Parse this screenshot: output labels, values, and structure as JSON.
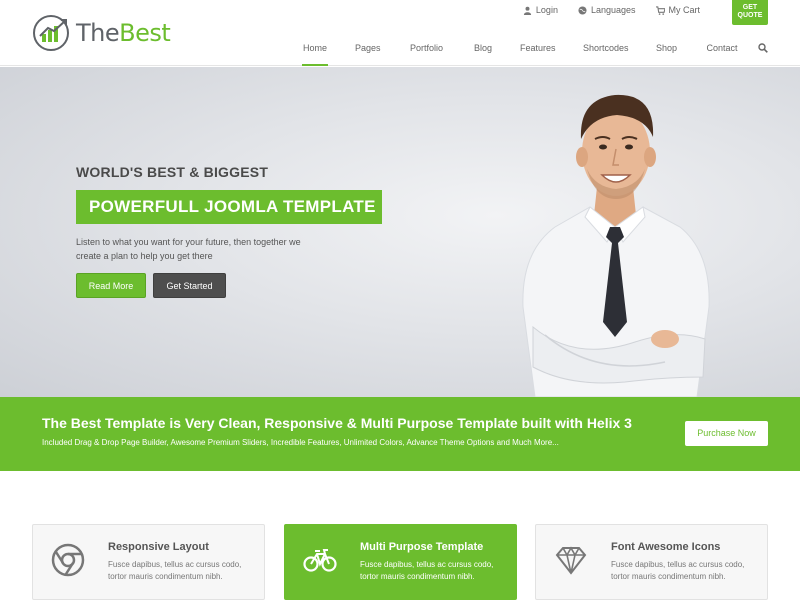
{
  "brand": {
    "name_part1": "The",
    "name_part2": "Best",
    "colors": {
      "accent": "#6cbd2e",
      "dark_button": "#4e4e4e",
      "text": "#555555"
    }
  },
  "topbar": [
    {
      "label": "Login",
      "icon": "user-icon"
    },
    {
      "label": "Languages",
      "icon": "globe-icon"
    },
    {
      "label": "My Cart",
      "icon": "cart-icon"
    }
  ],
  "get_quote": {
    "line1": "GET",
    "line2": "QUOTE"
  },
  "nav": {
    "items": [
      {
        "label": "Home",
        "active": true
      },
      {
        "label": "Pages"
      },
      {
        "label": "Portfolio"
      },
      {
        "label": "Blog"
      },
      {
        "label": "Features"
      },
      {
        "label": "Shortcodes"
      },
      {
        "label": "Shop"
      },
      {
        "label": "Contact"
      }
    ],
    "search_icon": "search-icon"
  },
  "hero": {
    "kicker": "WORLD'S BEST & BIGGEST",
    "headline": "POWERFULL JOOMLA TEMPLATE",
    "description": "Listen to what you want for your future, then together we create a plan to help you get there",
    "primary_button": "Read More",
    "secondary_button": "Get Started"
  },
  "banner": {
    "title": "The Best Template is Very Clean, Responsive & Multi Purpose Template built with Helix 3",
    "subtitle": "Included Drag & Drop Page Builder, Awesome Premium Sliders, Incredible Features, Unlimited Colors, Advance Theme Options and Much More...",
    "button": "Purchase Now"
  },
  "features": [
    {
      "title": "Responsive Layout",
      "text": "Fusce dapibus, tellus ac cursus codo, tortor mauris condimentum nibh.",
      "icon": "chrome-icon"
    },
    {
      "title": "Multi Purpose Template",
      "text": "Fusce dapibus, tellus ac cursus codo, tortor mauris condimentum nibh.",
      "icon": "bicycle-icon",
      "active": true
    },
    {
      "title": "Font Awesome Icons",
      "text": "Fusce dapibus, tellus ac cursus codo, tortor mauris condimentum nibh.",
      "icon": "diamond-icon"
    }
  ]
}
